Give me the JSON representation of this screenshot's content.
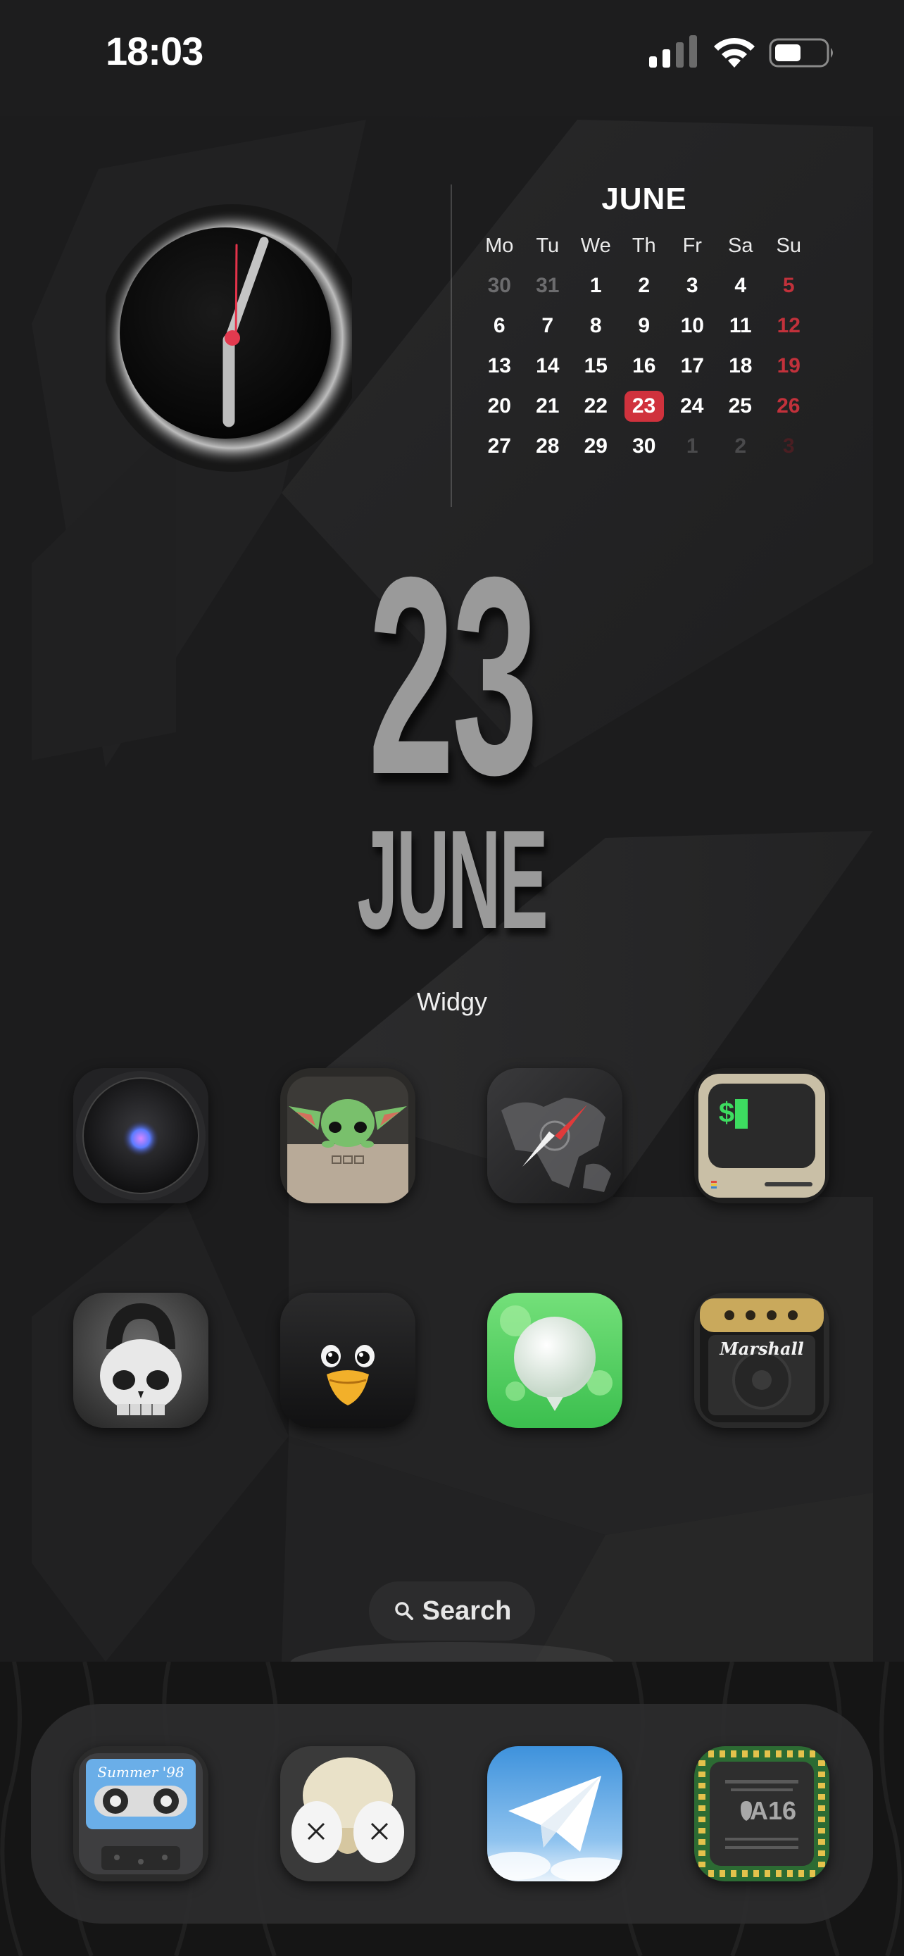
{
  "status_bar": {
    "time": "18:03"
  },
  "calendar": {
    "month": "JUNE",
    "weekdays": [
      "Mo",
      "Tu",
      "We",
      "Th",
      "Fr",
      "Sa",
      "Su"
    ],
    "weeks": [
      [
        "30",
        "31",
        "1",
        "2",
        "3",
        "4",
        "5"
      ],
      [
        "6",
        "7",
        "8",
        "9",
        "10",
        "11",
        "12"
      ],
      [
        "13",
        "14",
        "15",
        "16",
        "17",
        "18",
        "19"
      ],
      [
        "20",
        "21",
        "22",
        "23",
        "24",
        "25",
        "26"
      ],
      [
        "27",
        "28",
        "29",
        "30",
        "1",
        "2",
        "3"
      ]
    ],
    "today": "23"
  },
  "date_widget": {
    "day": "23",
    "month": "JUNE",
    "label": "Widgy"
  },
  "apps": {
    "row1": [
      "siri-speaker-icon",
      "baby-yoda-icon",
      "compass-globe-icon",
      "terminal-computer-icon"
    ],
    "row2": [
      "kettlebell-skull-icon",
      "penguin-icon",
      "bubble-app-icon",
      "marshall-amp-icon"
    ]
  },
  "search": {
    "label": "Search"
  },
  "dock": {
    "apps": [
      "cassette-icon",
      "kaws-icon",
      "telegram-icon",
      "a16-chip-icon"
    ],
    "cassette_text": "Summer '98",
    "chip_brand": "A16",
    "amp_brand": "Marshall"
  },
  "colors": {
    "background": "#1b1b1c",
    "accent_red": "#d0323d",
    "big_date_gray": "#9a9a9a"
  }
}
